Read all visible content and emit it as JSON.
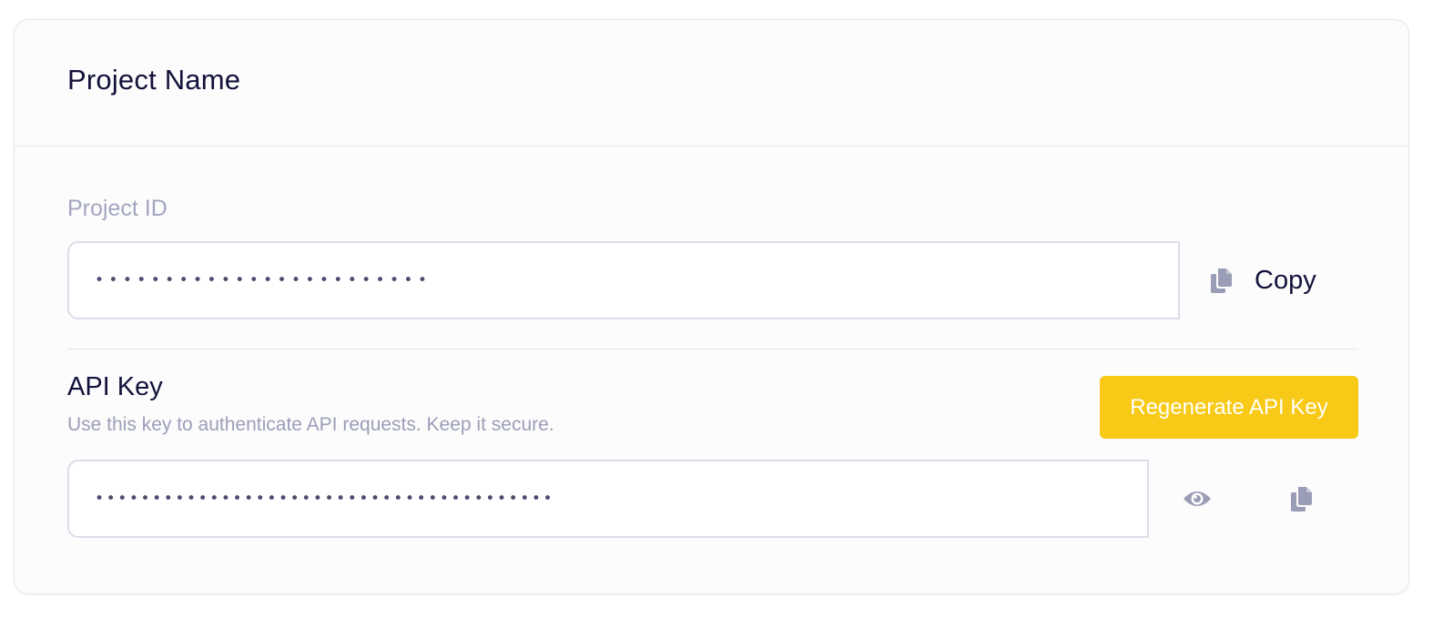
{
  "header": {
    "title": "Project Name"
  },
  "project_id": {
    "label": "Project ID",
    "masked_value": "••••••••••••••••••••••••",
    "copy_label": "Copy"
  },
  "api_key": {
    "title": "API Key",
    "description": "Use this key to authenticate API requests. Keep it secure.",
    "regenerate_label": "Regenerate API Key",
    "masked_value": "••••••••••••••••••••••••••••••••••••••••"
  },
  "icons": {
    "copy": "copy-icon",
    "visibility": "eye-icon"
  },
  "colors": {
    "accent": "#f8c916",
    "title_text": "#12123a",
    "muted_text": "#a3a6bf",
    "icon_gray": "#9a9db6",
    "dot_color": "#4b4c70",
    "border": "#dcdde7"
  }
}
